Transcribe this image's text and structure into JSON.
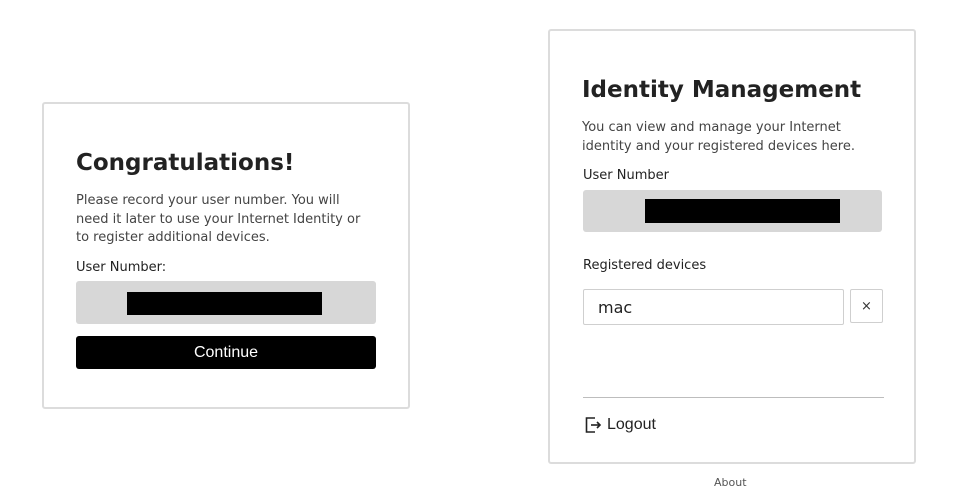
{
  "congrats_card": {
    "title": "Congratulations!",
    "description": "Please record your user number. You will need it later to use your Internet Identity or to register additional devices.",
    "user_number_label": "User Number:",
    "user_number_value": "",
    "continue_label": "Continue"
  },
  "management_card": {
    "title": "Identity Management",
    "description": "You can view and manage your Internet identity and your registered devices here.",
    "user_number_label": "User Number",
    "user_number_value": "",
    "registered_devices_label": "Registered devices",
    "devices": [
      {
        "name": "mac",
        "remove_label": "×"
      }
    ],
    "logout_label": "Logout",
    "logout_icon": "logout-icon"
  },
  "footer": {
    "about_label": "About"
  },
  "colors": {
    "button_bg": "#000000",
    "number_box_bg": "#d7d7d7",
    "card_border": "#dcdcdc"
  }
}
